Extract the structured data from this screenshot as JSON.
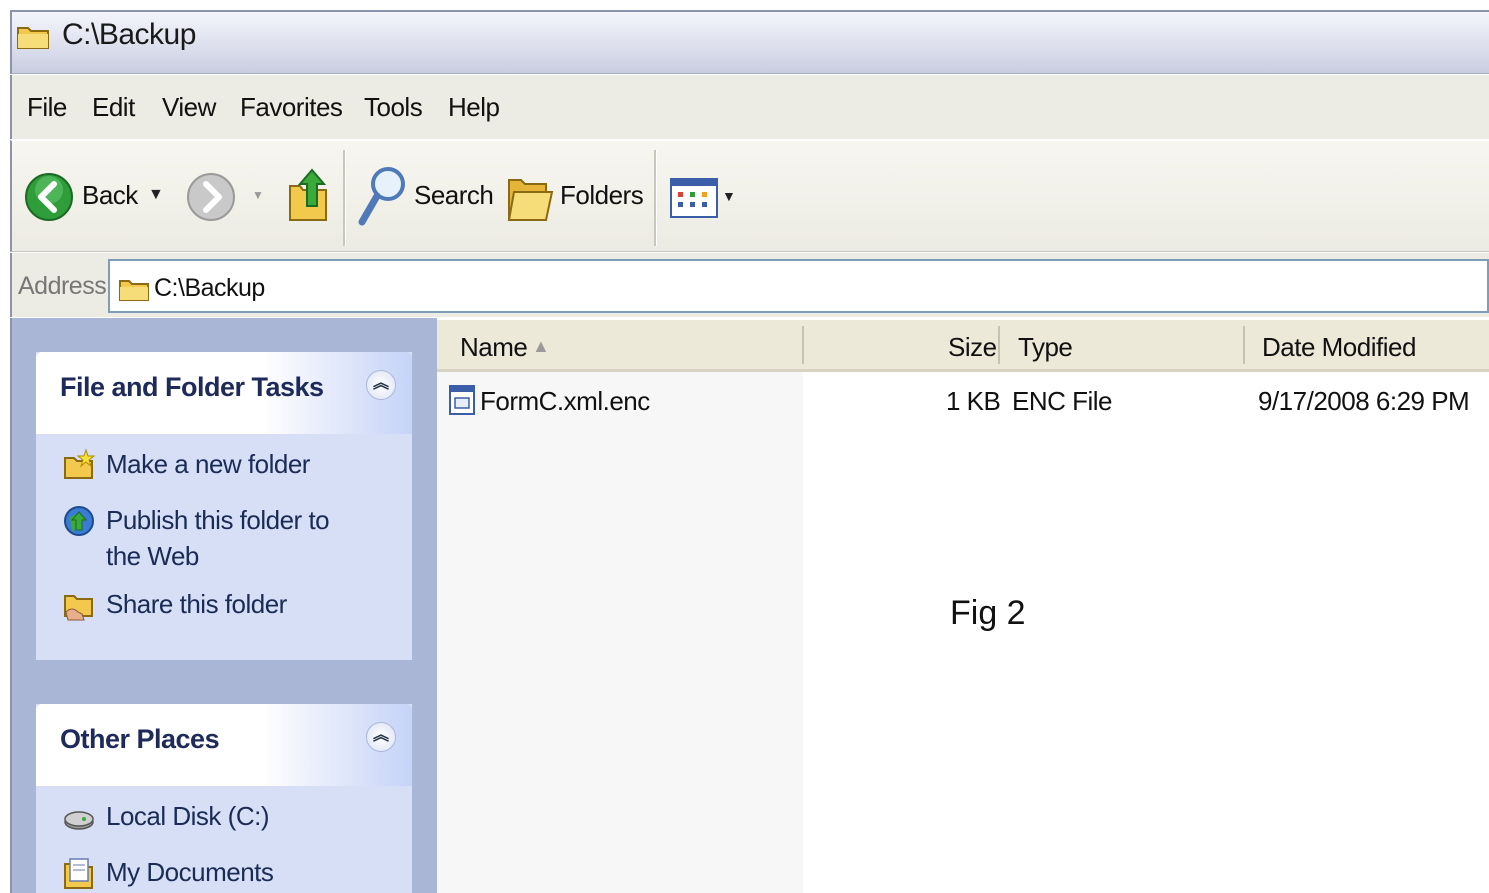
{
  "window": {
    "title": "C:\\Backup"
  },
  "menu": {
    "items": [
      "File",
      "Edit",
      "View",
      "Favorites",
      "Tools",
      "Help"
    ]
  },
  "toolbar": {
    "back_label": "Back",
    "search_label": "Search",
    "folders_label": "Folders"
  },
  "address": {
    "label": "Address",
    "value": "C:\\Backup"
  },
  "tasks_panel": {
    "title": "File and Folder Tasks",
    "items": [
      "Make a new folder",
      "Publish this folder to the Web",
      "Share this folder"
    ]
  },
  "places_panel": {
    "title": "Other Places",
    "items": [
      "Local Disk (C:)",
      "My Documents"
    ]
  },
  "file_list": {
    "columns": {
      "name": "Name",
      "size": "Size",
      "type": "Type",
      "date": "Date Modified"
    },
    "sort_column": "Name",
    "sort_direction": "ascending",
    "rows": [
      {
        "name": "FormC.xml.enc",
        "size": "1 KB",
        "type": "ENC File",
        "date": "9/17/2008 6:29 PM"
      }
    ]
  },
  "caption": "Fig 2",
  "colors": {
    "folder_yellow": "#f2c94c",
    "back_green": "#2f9e3a",
    "panel_blue": "#d6dff5",
    "panel_title": "#1d2a5a"
  }
}
